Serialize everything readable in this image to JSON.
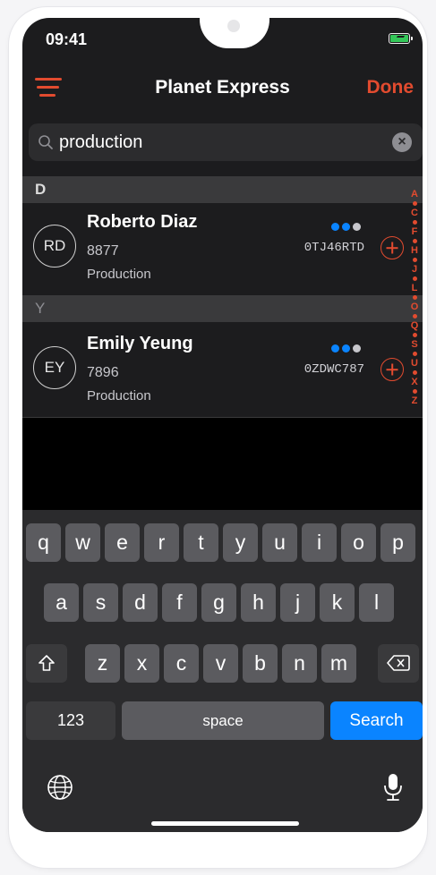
{
  "status_bar": {
    "time": "09:41"
  },
  "nav": {
    "title": "Planet Express",
    "done_label": "Done"
  },
  "search": {
    "query": "production"
  },
  "sections": [
    {
      "letter": "D"
    },
    {
      "letter": "Y"
    }
  ],
  "contacts": [
    {
      "initials": "RD",
      "name": "Roberto Diaz",
      "ext": "8877",
      "department": "Production",
      "code": "0TJ46RTD",
      "dots": [
        "#0a84ff",
        "#0a84ff",
        "#c7c7cc"
      ]
    },
    {
      "initials": "EY",
      "name": "Emily Yeung",
      "ext": "7896",
      "department": "Production",
      "code": "0ZDWC787",
      "dots": [
        "#0a84ff",
        "#0a84ff",
        "#c7c7cc"
      ]
    }
  ],
  "index_letters": [
    "A",
    "C",
    "F",
    "H",
    "J",
    "L",
    "O",
    "Q",
    "S",
    "U",
    "X",
    "Z"
  ],
  "keyboard": {
    "row1": [
      "q",
      "w",
      "e",
      "r",
      "t",
      "y",
      "u",
      "i",
      "o",
      "p"
    ],
    "row2": [
      "a",
      "s",
      "d",
      "f",
      "g",
      "h",
      "j",
      "k",
      "l"
    ],
    "row3": [
      "z",
      "x",
      "c",
      "v",
      "b",
      "n",
      "m"
    ],
    "numbers_label": "123",
    "space_label": "space",
    "search_label": "Search"
  },
  "colors": {
    "accent": "#e24b2f",
    "keyboard_blue": "#0a84ff",
    "background": "#1c1c1e"
  },
  "icons": [
    "hamburger-icon",
    "search-icon",
    "clear-icon",
    "add-icon",
    "shift-icon",
    "backspace-icon",
    "globe-icon",
    "microphone-icon",
    "battery-icon"
  ]
}
